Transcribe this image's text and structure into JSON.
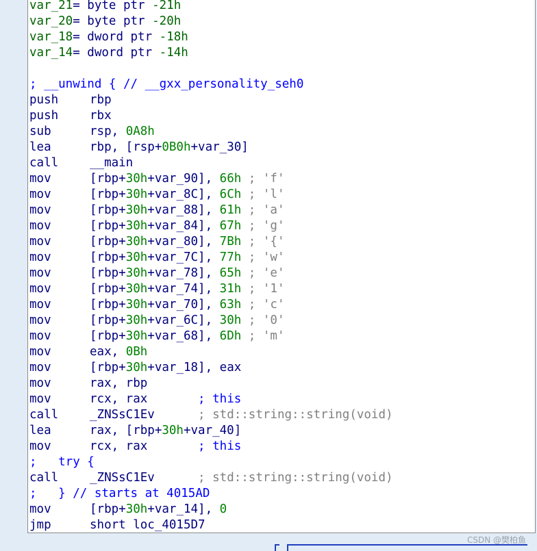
{
  "vars": [
    {
      "name": "var_21",
      "eq": "=",
      "kind": "byte ptr",
      "size": "-21h"
    },
    {
      "name": "var_20",
      "eq": "=",
      "kind": "byte ptr",
      "size": "-20h"
    },
    {
      "name": "var_18",
      "eq": "=",
      "kind": "dword ptr",
      "size": "-18h"
    },
    {
      "name": "var_14",
      "eq": "=",
      "kind": "dword ptr",
      "size": "-14h"
    }
  ],
  "unwind_comment": "; __unwind { // __gxx_personality_seh0",
  "prologue": [
    {
      "m": "push",
      "a": "rbp"
    },
    {
      "m": "push",
      "a": "rbx"
    },
    {
      "m": "sub",
      "a": "rsp, ",
      "n": "0A8h"
    },
    {
      "m": "lea",
      "a": "rbp, [rsp+",
      "n": "0B0h",
      "b": "+var_30]"
    },
    {
      "m": "call",
      "a": "__main"
    }
  ],
  "flag_moves": [
    {
      "m": "mov",
      "o": "[rbp+",
      "n1": "30h",
      "v": "+var_90], ",
      "n2": "66h",
      "c": " ; 'f'"
    },
    {
      "m": "mov",
      "o": "[rbp+",
      "n1": "30h",
      "v": "+var_8C], ",
      "n2": "6Ch",
      "c": " ; 'l'"
    },
    {
      "m": "mov",
      "o": "[rbp+",
      "n1": "30h",
      "v": "+var_88], ",
      "n2": "61h",
      "c": " ; 'a'"
    },
    {
      "m": "mov",
      "o": "[rbp+",
      "n1": "30h",
      "v": "+var_84], ",
      "n2": "67h",
      "c": " ; 'g'"
    },
    {
      "m": "mov",
      "o": "[rbp+",
      "n1": "30h",
      "v": "+var_80], ",
      "n2": "7Bh",
      "c": " ; '{'"
    },
    {
      "m": "mov",
      "o": "[rbp+",
      "n1": "30h",
      "v": "+var_7C], ",
      "n2": "77h",
      "c": " ; 'w'"
    },
    {
      "m": "mov",
      "o": "[rbp+",
      "n1": "30h",
      "v": "+var_78], ",
      "n2": "65h",
      "c": " ; 'e'"
    },
    {
      "m": "mov",
      "o": "[rbp+",
      "n1": "30h",
      "v": "+var_74], ",
      "n2": "31h",
      "c": " ; '1'"
    },
    {
      "m": "mov",
      "o": "[rbp+",
      "n1": "30h",
      "v": "+var_70], ",
      "n2": "63h",
      "c": " ; 'c'"
    },
    {
      "m": "mov",
      "o": "[rbp+",
      "n1": "30h",
      "v": "+var_6C], ",
      "n2": "30h",
      "c": " ; '0'"
    },
    {
      "m": "mov",
      "o": "[rbp+",
      "n1": "30h",
      "v": "+var_68], ",
      "n2": "6Dh",
      "c": " ; 'm'"
    }
  ],
  "tail": [
    {
      "m": "mov",
      "a": "eax, ",
      "n": "0Bh"
    },
    {
      "m": "mov",
      "a": "[rbp+",
      "n": "30h",
      "b": "+var_18], eax"
    },
    {
      "m": "mov",
      "a": "rax, rbp"
    },
    {
      "m": "mov",
      "a": "rcx, rax       ",
      "cb": "; this"
    },
    {
      "m": "call",
      "a": "_ZNSsC1Ev      ",
      "cg": "; std::string::string(void)"
    },
    {
      "m": "lea",
      "a": "rax, [rbp+",
      "n": "30h",
      "b": "+var_40]"
    },
    {
      "m": "mov",
      "a": "rcx, rax       ",
      "cb": "; this"
    },
    {
      "raw": ";   try {"
    },
    {
      "m": "call",
      "a": "_ZNSsC1Ev      ",
      "cg": "; std::string::string(void)"
    },
    {
      "raw": ";   } // starts at 4015AD"
    },
    {
      "m": "mov",
      "a": "[rbp+",
      "n": "30h",
      "b": "+var_14], ",
      "n2": "0"
    },
    {
      "m": "jmp",
      "a": "short loc_4015D7"
    }
  ],
  "watermark": "CSDN @樊柏鱼"
}
